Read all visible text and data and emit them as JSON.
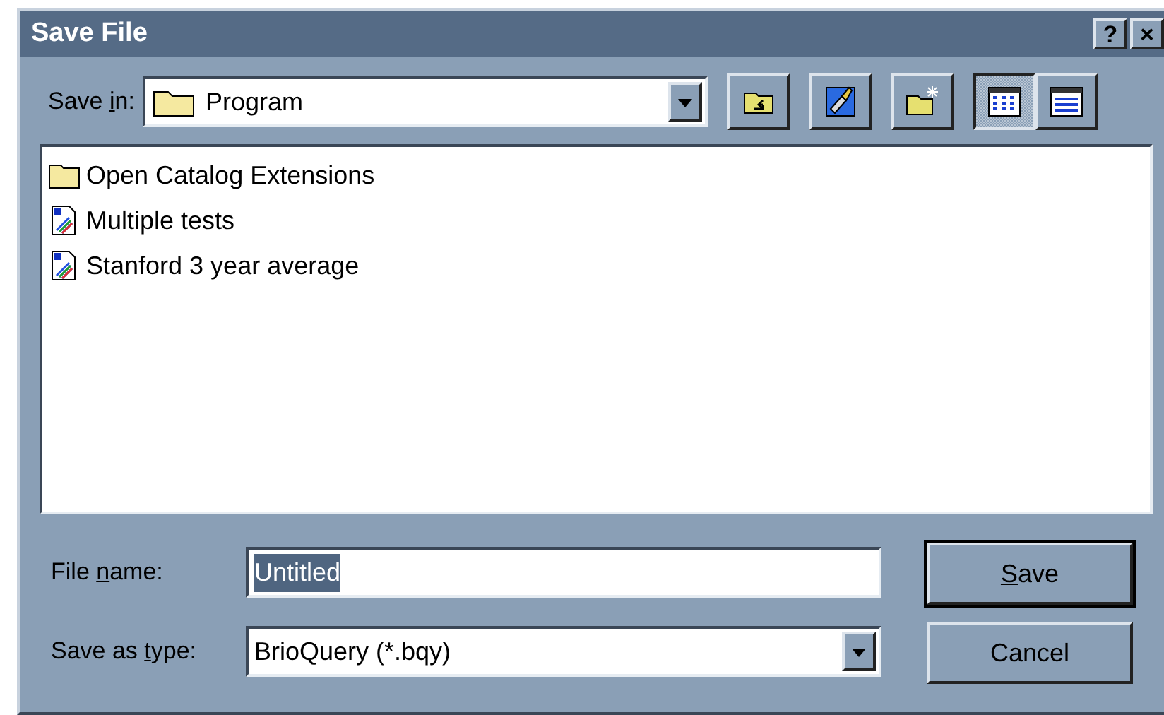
{
  "window": {
    "title": "Save File",
    "title_buttons": [
      "?",
      "×"
    ]
  },
  "save_in": {
    "label_parts": [
      {
        "text": "Save ",
        "underlined": false
      },
      {
        "text": "i",
        "underlined": true
      },
      {
        "text": "n:",
        "underlined": false
      }
    ],
    "value": "Program"
  },
  "toolbar": [
    {
      "kind": "up-folder"
    },
    {
      "kind": "desktop"
    },
    {
      "kind": "new-folder"
    },
    {
      "kind": "list-view",
      "selected": true
    },
    {
      "kind": "details-view",
      "selected": false
    }
  ],
  "files": [
    {
      "kind": "folder",
      "name": "Open Catalog Extensions"
    },
    {
      "kind": "document",
      "name": "Multiple tests"
    },
    {
      "kind": "document",
      "name": "Stanford 3 year average"
    }
  ],
  "file_name": {
    "label_parts": [
      {
        "text": "File ",
        "underlined": false
      },
      {
        "text": "n",
        "underlined": true
      },
      {
        "text": "ame:",
        "underlined": false
      }
    ],
    "value": "Untitled",
    "text_selected": true
  },
  "save_as_type": {
    "label_parts": [
      {
        "text": "Save as ",
        "underlined": false
      },
      {
        "text": "t",
        "underlined": true
      },
      {
        "text": "ype:",
        "underlined": false
      }
    ],
    "value": "BrioQuery (*.bqy)"
  },
  "buttons": [
    {
      "label_parts": [
        {
          "text": "S",
          "underlined": true
        },
        {
          "text": "ave",
          "underlined": false
        }
      ],
      "default": true
    },
    {
      "label_parts": [
        {
          "text": "Cancel",
          "underlined": false
        }
      ],
      "default": false
    }
  ]
}
